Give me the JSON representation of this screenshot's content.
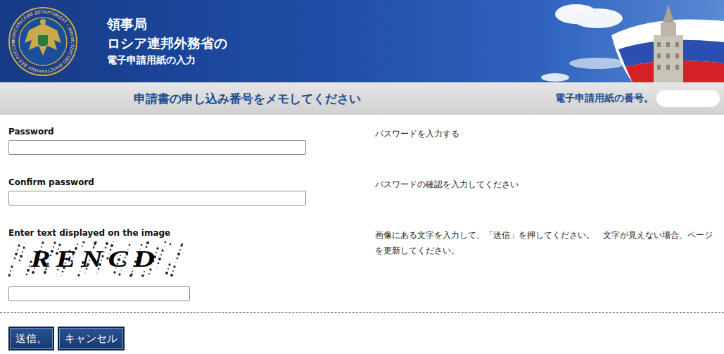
{
  "header": {
    "emblem_ring_text": "КОНСУЛЬСКИЙ ДЕПАРТАМЕНТ • МИНИСТЕРСТВО ИНОСТРАННЫХ ДЕЛ РОССИИ",
    "lines": [
      "領事局",
      "ロシア連邦外務省の",
      "電子申請用紙の入力"
    ]
  },
  "notice_bar": {
    "message": "申請書の申し込み番号をメモしてください",
    "number_label": "電子申請用紙の番号。",
    "number_value": ""
  },
  "fields": [
    {
      "kind": "password",
      "label": "Password",
      "hint": "パスワードを入力する",
      "value": ""
    },
    {
      "kind": "password",
      "label": "Confirm password",
      "hint": "パスワードの確認を入力してください",
      "value": ""
    },
    {
      "kind": "captcha",
      "label": "Enter text displayed on the image",
      "hint": "画像にある文字を入力して、「送信」を押してください。　文字が見えない場合、ページを更新してください。",
      "captcha": "RENCD",
      "value": ""
    }
  ],
  "buttons": [
    {
      "label": "送信。"
    },
    {
      "label": "キャンセル"
    }
  ]
}
